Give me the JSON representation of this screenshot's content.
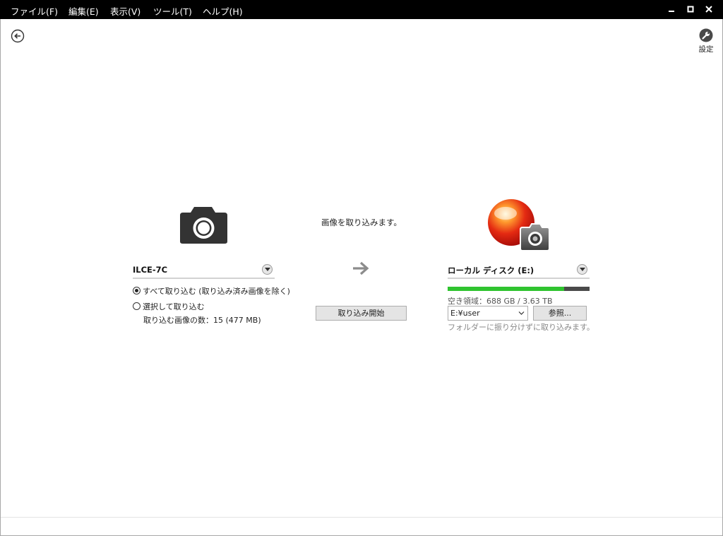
{
  "menu": {
    "file": "ファイル(F)",
    "edit": "編集(E)",
    "view": "表示(V)",
    "tools": "ツール(T)",
    "help": "ヘルプ(H)"
  },
  "window_controls": {
    "minimize": "–",
    "maximize": "☐",
    "close": "✕"
  },
  "toolbar": {
    "back_icon": "back-arrow-circle-icon",
    "settings_icon": "wrench-icon",
    "settings_label": "設定"
  },
  "source": {
    "device_name": "ILCE-7C",
    "options": [
      {
        "label": "すべて取り込む (取り込み済み画像を除く)",
        "selected": true
      },
      {
        "label": "選択して取り込む",
        "selected": false
      }
    ],
    "count_text": "取り込む画像の数：15 (477 MB)"
  },
  "center": {
    "heading": "画像を取り込みます。",
    "arrow_icon": "right-arrow-icon",
    "import_button": "取り込み開始"
  },
  "destination": {
    "name": "ローカル ディスク (E:)",
    "space_text": "空き領域：688 GB / 3.63 TB",
    "used_fraction": 0.82,
    "folder_value": "E:¥user",
    "browse_button": "参照...",
    "hint": "フォルダーに振り分けずに取り込みます。"
  },
  "colors": {
    "menubar_bg": "#000000",
    "storage_used": "#2fc42f",
    "storage_total": "#4a4a4a"
  }
}
